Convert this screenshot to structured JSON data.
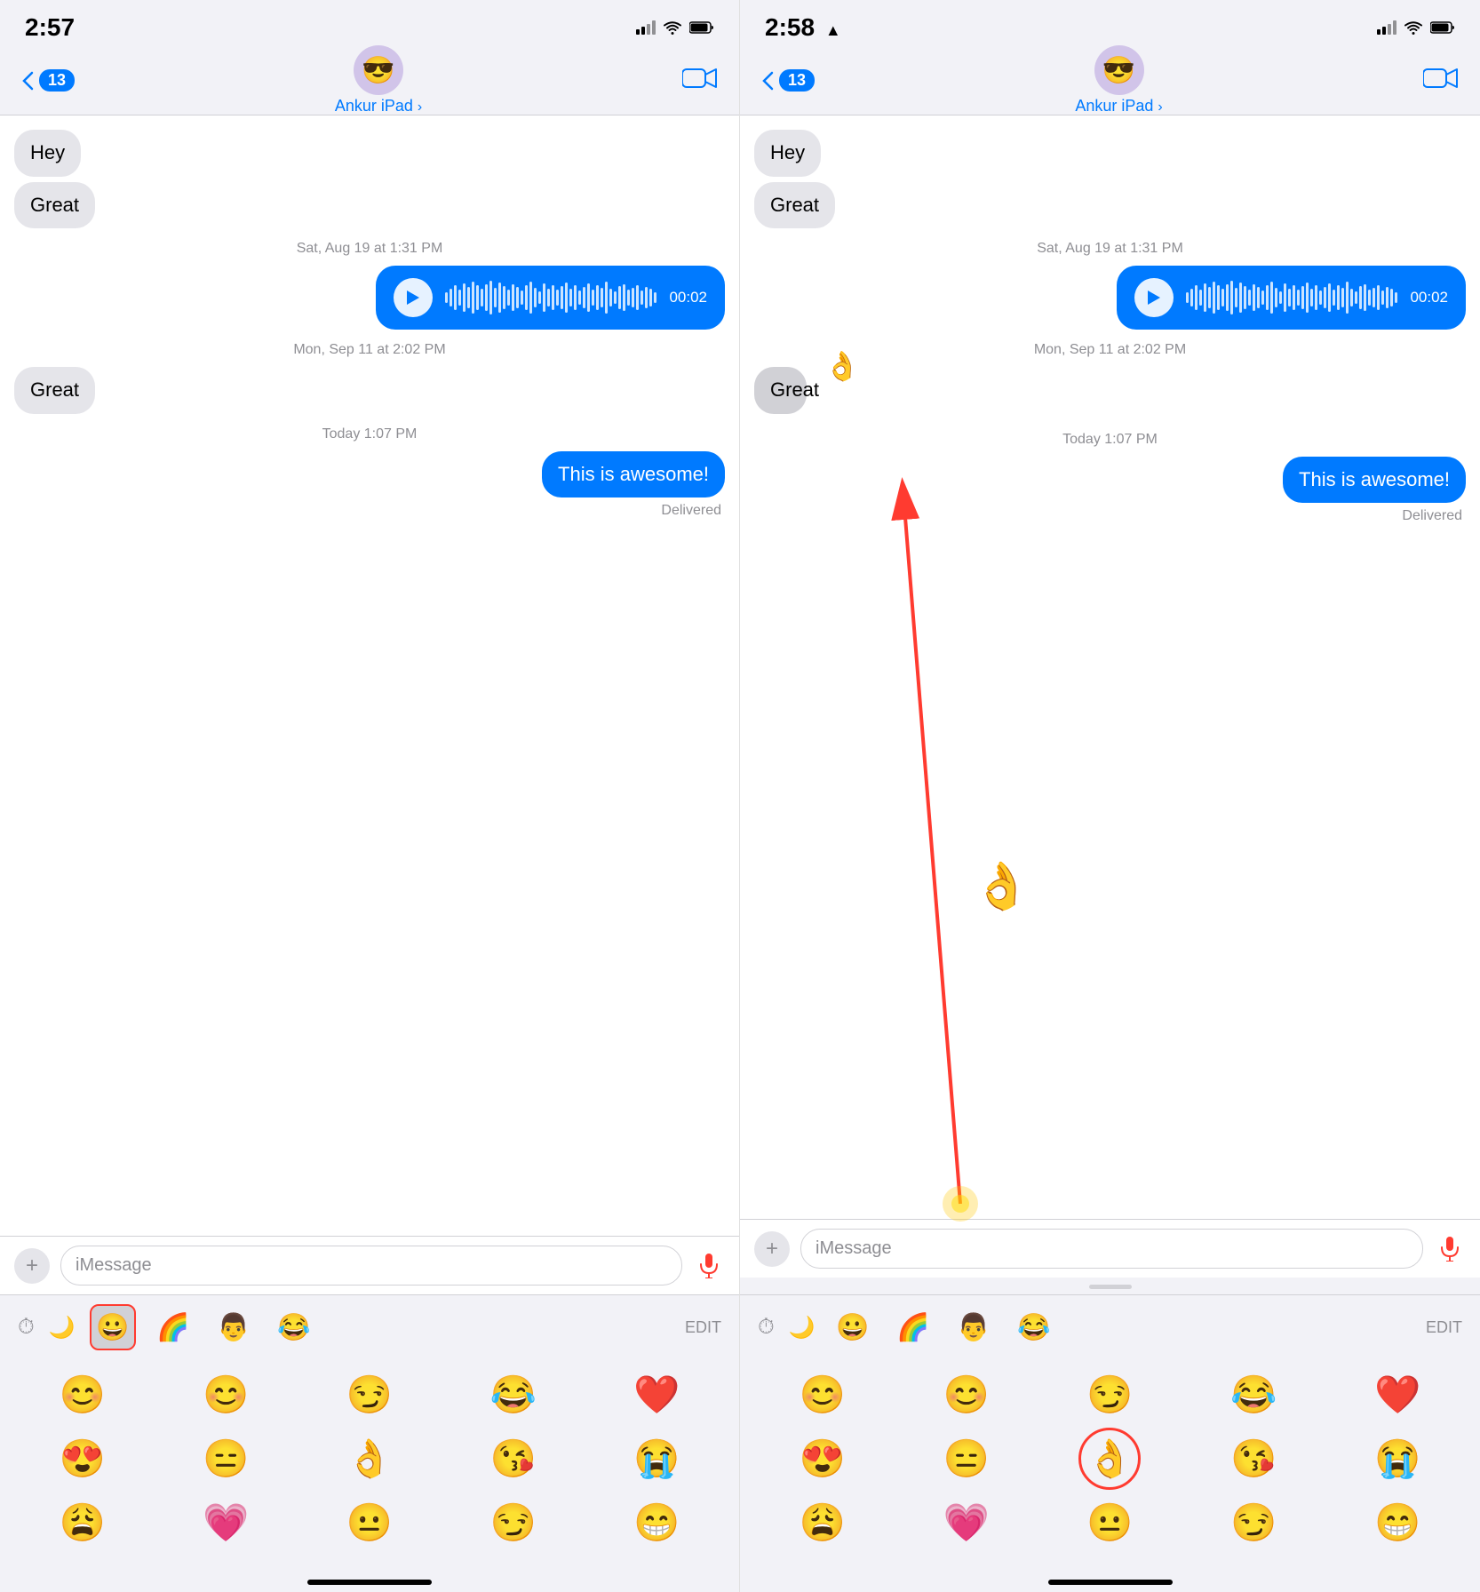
{
  "left_panel": {
    "status_bar": {
      "time": "2:57",
      "signal": "signal-icon",
      "wifi": "wifi-icon",
      "battery": "battery-icon"
    },
    "nav": {
      "back_label": "13",
      "contact_name": "Ankur iPad",
      "video_icon": "video-icon"
    },
    "messages": [
      {
        "id": "hey",
        "text": "Hey",
        "type": "received"
      },
      {
        "id": "great1",
        "text": "Great",
        "type": "received"
      },
      {
        "id": "ts1",
        "text": "Sat, Aug 19 at 1:31 PM",
        "type": "timestamp"
      },
      {
        "id": "audio1",
        "text": "",
        "type": "audio",
        "duration": "00:02"
      },
      {
        "id": "ts2",
        "text": "Mon, Sep 11 at 2:02 PM",
        "type": "timestamp"
      },
      {
        "id": "great2",
        "text": "Great",
        "type": "received"
      },
      {
        "id": "ts3",
        "text": "Today 1:07 PM",
        "type": "timestamp"
      },
      {
        "id": "awesome",
        "text": "This is awesome!",
        "type": "sent"
      },
      {
        "id": "delivered",
        "text": "Delivered",
        "type": "delivered"
      }
    ],
    "input": {
      "placeholder": "iMessage",
      "plus_icon": "+",
      "mic_icon": "mic-icon"
    },
    "emoji_bar": {
      "recent_icon": "⏱",
      "moon_icon": "🌙",
      "items": [
        "😀",
        "🌈",
        "👨",
        "😂"
      ],
      "selected_index": 2,
      "edit_label": "EDIT"
    },
    "emoji_grid": [
      "😊",
      "😊",
      "😏",
      "😂",
      "❤️",
      "😍",
      "😑",
      "👌",
      "😘",
      "😭",
      "😩",
      "💗",
      "😐",
      "😏",
      "😁"
    ]
  },
  "right_panel": {
    "status_bar": {
      "time": "2:58",
      "signal": "signal-icon",
      "wifi": "wifi-icon",
      "battery": "battery-icon",
      "location": "location-icon"
    },
    "nav": {
      "back_label": "13",
      "contact_name": "Ankur iPad",
      "video_icon": "video-icon"
    },
    "messages": [
      {
        "id": "hey",
        "text": "Hey",
        "type": "received"
      },
      {
        "id": "great1",
        "text": "Great",
        "type": "received"
      },
      {
        "id": "ts1",
        "text": "Sat, Aug 19 at 1:31 PM",
        "type": "timestamp"
      },
      {
        "id": "audio1",
        "text": "",
        "type": "audio",
        "duration": "00:02"
      },
      {
        "id": "ts2",
        "text": "Mon, Sep 11 at 2:02 PM",
        "type": "timestamp"
      },
      {
        "id": "great2",
        "text": "Great",
        "type": "received"
      },
      {
        "id": "ts3",
        "text": "Today 1:07 PM",
        "type": "timestamp"
      },
      {
        "id": "awesome",
        "text": "This is awesome!",
        "type": "sent"
      },
      {
        "id": "delivered",
        "text": "Delivered",
        "type": "delivered"
      }
    ],
    "input": {
      "placeholder": "iMessage",
      "plus_icon": "+",
      "mic_icon": "mic-icon"
    },
    "emoji_bar": {
      "recent_icon": "⏱",
      "moon_icon": "🌙",
      "items": [
        "😀",
        "🌈",
        "👨",
        "😂"
      ],
      "selected_index": 2,
      "edit_label": "EDIT"
    },
    "emoji_grid": [
      "😊",
      "😊",
      "😏",
      "😂",
      "❤️",
      "😍",
      "😑",
      "👌",
      "😘",
      "😭",
      "😩",
      "💗",
      "😐",
      "😏",
      "😁"
    ],
    "annotation": {
      "circle_emoji": "👌",
      "flying_emoji": "👌",
      "arrow": "red-arrow"
    }
  }
}
